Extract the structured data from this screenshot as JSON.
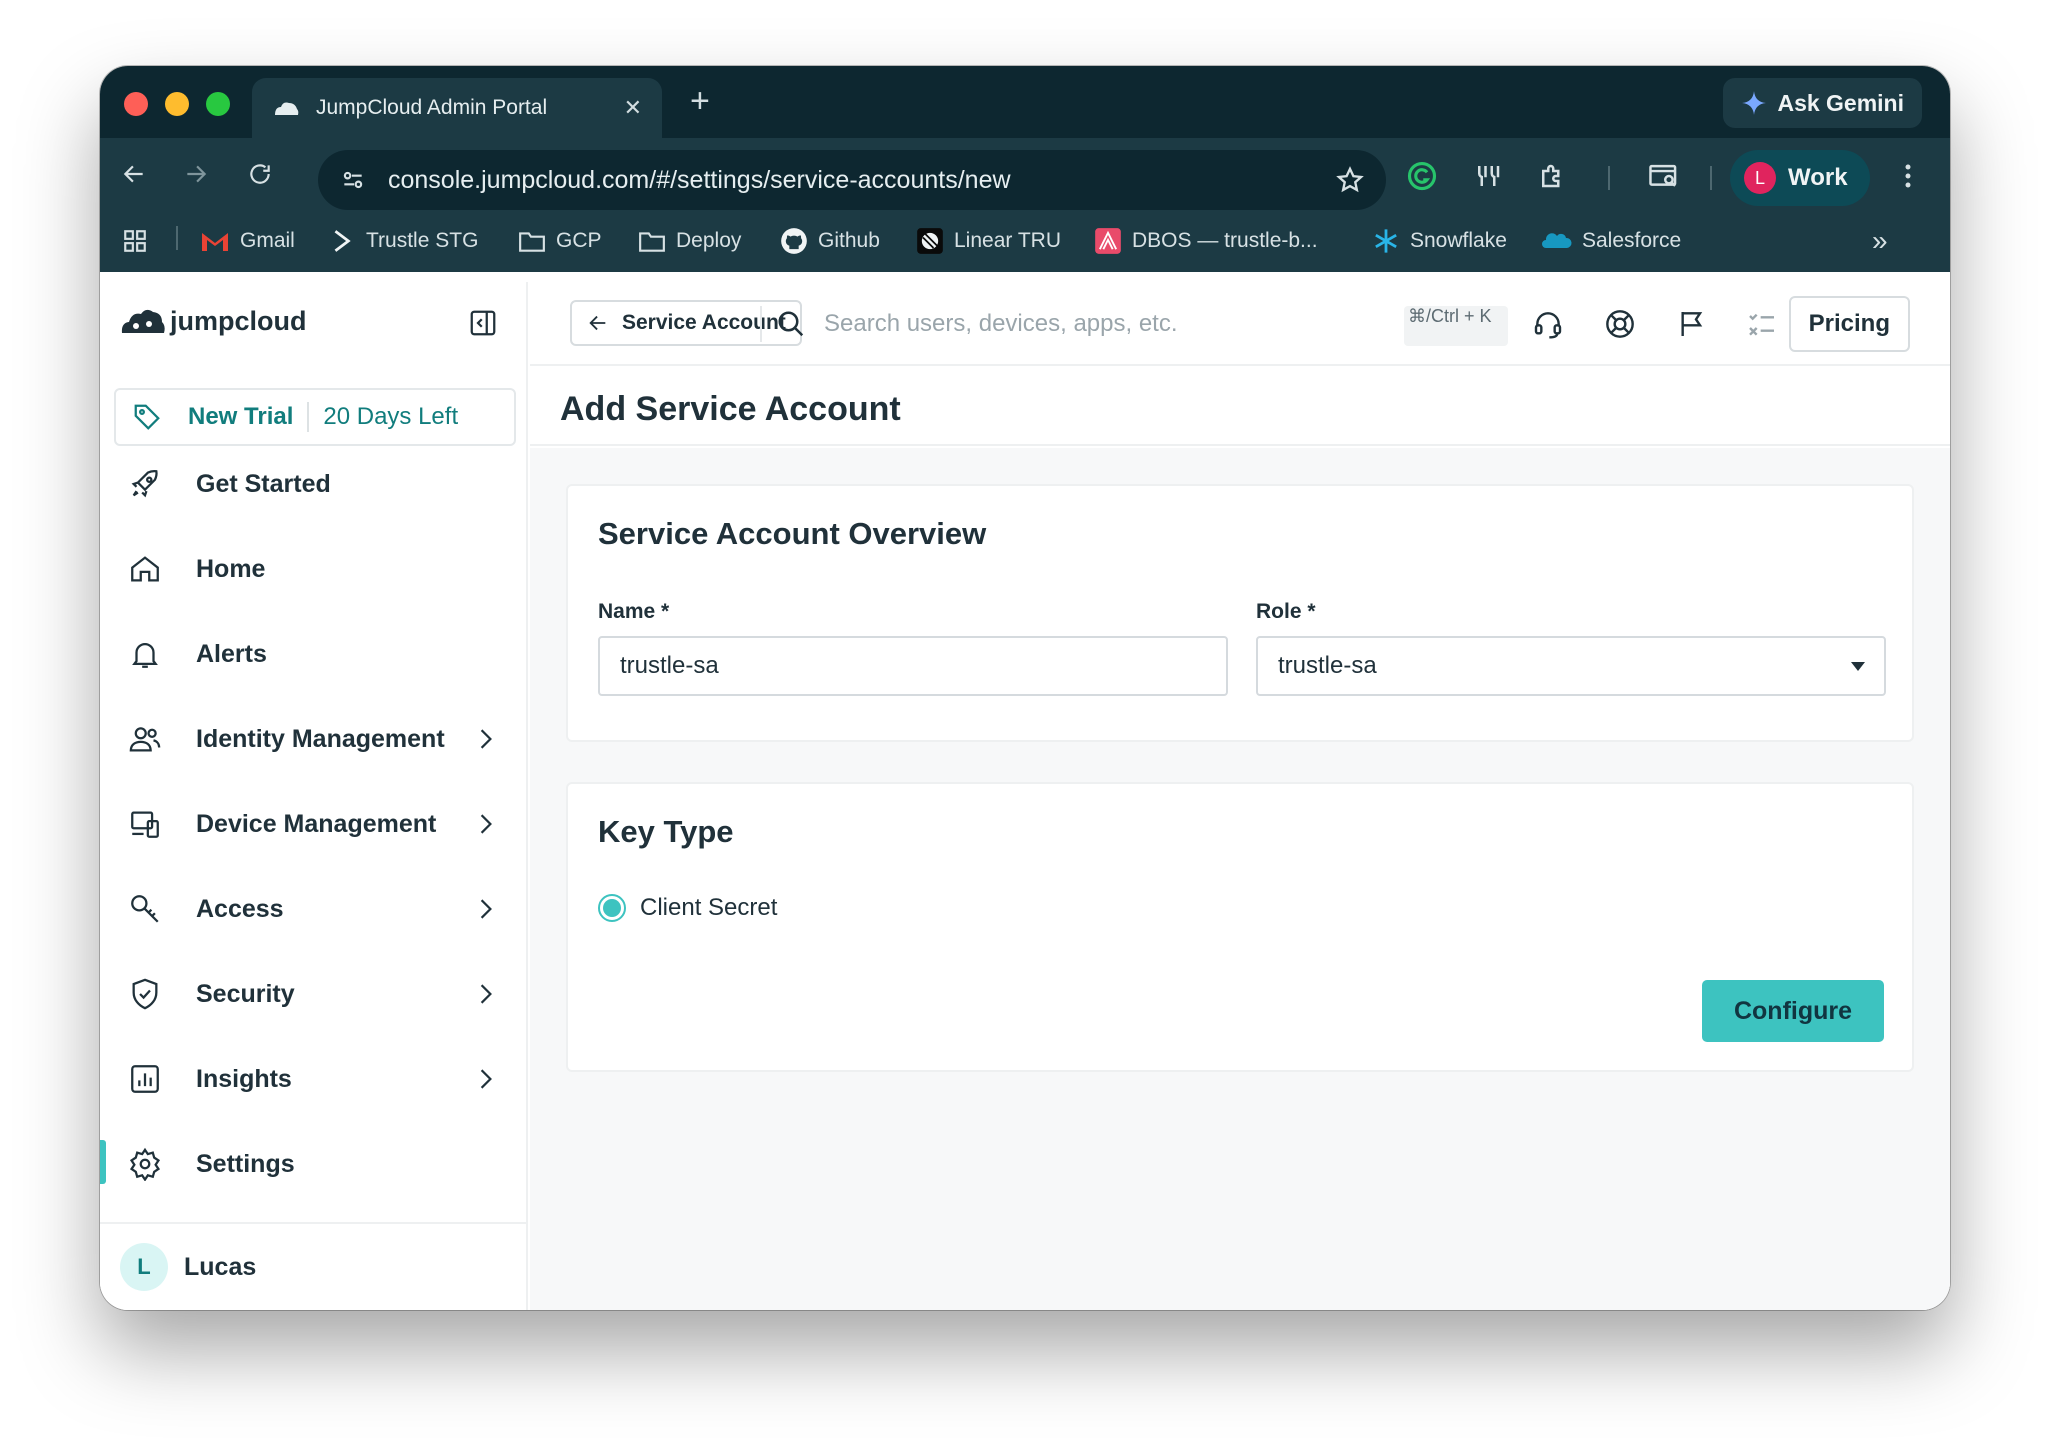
{
  "browser": {
    "tab_title": "JumpCloud Admin Portal",
    "tab_close": "✕",
    "new_tab": "+",
    "ask_gemini": "Ask Gemini",
    "url": "console.jumpcloud.com/#/settings/service-accounts/new",
    "profile_initial": "L",
    "profile_label": "Work",
    "bookmarks": [
      "Gmail",
      "Trustle STG",
      "GCP",
      "Deploy",
      "Github",
      "Linear TRU",
      "DBOS — trustle-b...",
      "Snowflake",
      "Salesforce"
    ],
    "bookmarks_overflow": "»"
  },
  "sidebar": {
    "logo_text": "jumpcloud",
    "trial_label": "New Trial",
    "trial_days": "20 Days Left",
    "items": [
      {
        "label": "Get Started",
        "icon": "rocket-icon",
        "has_chevron": false
      },
      {
        "label": "Home",
        "icon": "home-icon",
        "has_chevron": false
      },
      {
        "label": "Alerts",
        "icon": "bell-icon",
        "has_chevron": false
      },
      {
        "label": "Identity Management",
        "icon": "users-icon",
        "has_chevron": true
      },
      {
        "label": "Device Management",
        "icon": "devices-icon",
        "has_chevron": true
      },
      {
        "label": "Access",
        "icon": "key-icon",
        "has_chevron": true
      },
      {
        "label": "Security",
        "icon": "shield-icon",
        "has_chevron": true
      },
      {
        "label": "Insights",
        "icon": "chart-icon",
        "has_chevron": true
      },
      {
        "label": "Settings",
        "icon": "gear-icon",
        "has_chevron": false,
        "active": true
      }
    ],
    "user_initial": "L",
    "user_name": "Lucas"
  },
  "topbar": {
    "back_label": "Service Account",
    "search_placeholder": "Search users, devices, apps, etc.",
    "shortcut": "⌘/Ctrl + K",
    "pricing_label": "Pricing"
  },
  "page": {
    "title": "Add Service Account",
    "overview": {
      "heading": "Service Account Overview",
      "name_label": "Name *",
      "name_value": "trustle-sa",
      "role_label": "Role *",
      "role_value": "trustle-sa"
    },
    "key_type": {
      "heading": "Key Type",
      "option_label": "Client Secret",
      "configure_label": "Configure"
    }
  },
  "colors": {
    "accent": "#3dc3c0",
    "chrome_dark": "#0d2730",
    "chrome": "#1c3a44",
    "text": "#20313a",
    "trial_text": "#117d7d"
  }
}
